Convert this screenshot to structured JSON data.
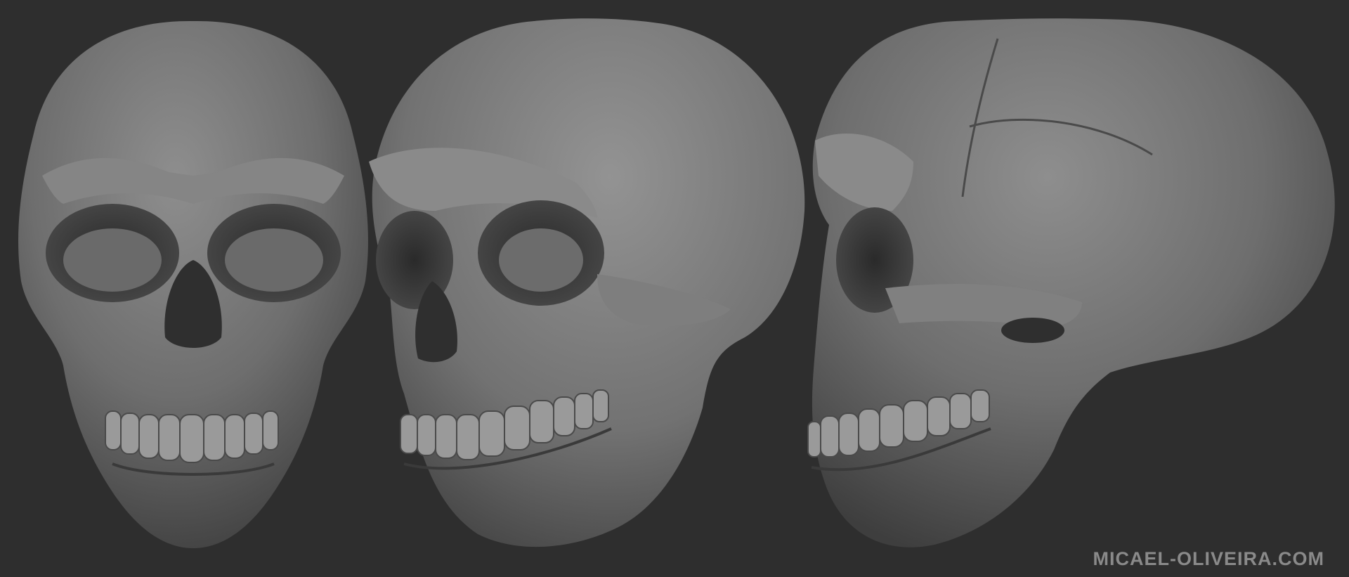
{
  "image": {
    "background_color": "#2e2e2e",
    "bone_color": "#777777",
    "views": [
      {
        "name": "front-view",
        "subject": "skull"
      },
      {
        "name": "three-quarter-view",
        "subject": "skull"
      },
      {
        "name": "side-view",
        "subject": "skull"
      }
    ],
    "watermark": "MICAEL-OLIVEIRA.COM"
  }
}
